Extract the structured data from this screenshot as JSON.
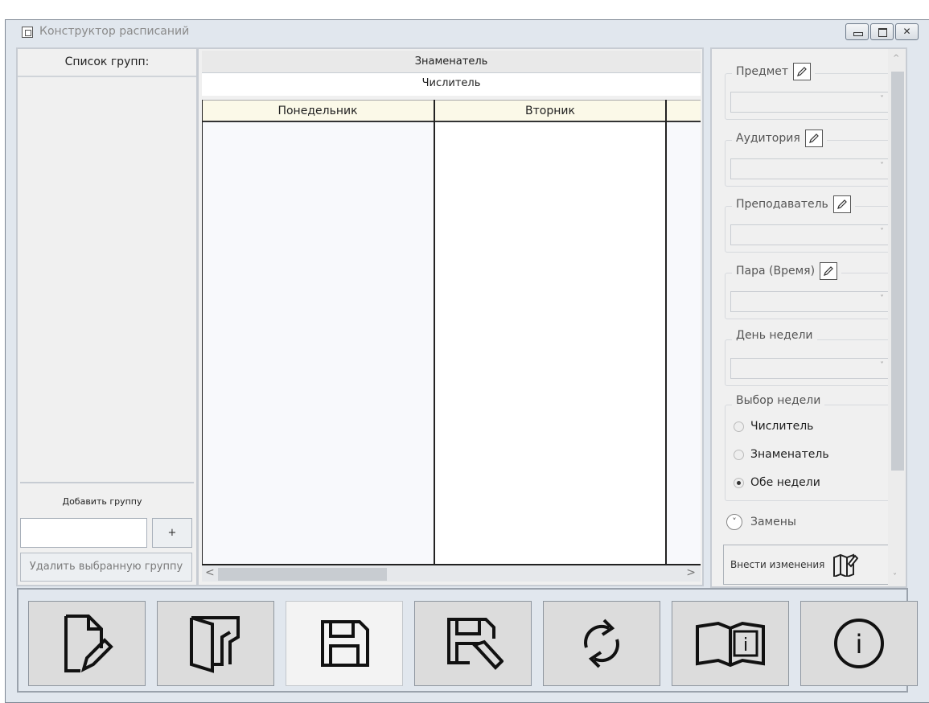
{
  "window": {
    "title": "Конструктор расписаний",
    "close_glyph": "✕"
  },
  "left_panel": {
    "header": "Список групп:",
    "add_label": "Добавить группу",
    "add_input_value": "",
    "add_button": "+",
    "delete_button": "Удалить выбранную группу"
  },
  "grid": {
    "denominator_header": "Знаменатель",
    "numerator_header": "Числитель",
    "days": [
      "Понедельник",
      "Вторник"
    ],
    "scroll_left": "<",
    "scroll_right": ">"
  },
  "right_panel": {
    "fields": [
      {
        "label": "Предмет",
        "icon": "pencil-icon",
        "value": ""
      },
      {
        "label": "Аудитория",
        "icon": "pencil-icon",
        "value": ""
      },
      {
        "label": "Преподаватель",
        "icon": "pencil-icon",
        "value": ""
      },
      {
        "label": "Пара (Время)",
        "icon": "pencil-icon",
        "value": ""
      },
      {
        "label": "День недели",
        "value": ""
      }
    ],
    "week_choice": {
      "label": "Выбор недели",
      "options": [
        "Числитель",
        "Знаменатель",
        "Обе недели"
      ],
      "selected": "Обе недели"
    },
    "replacements_label": "Замены",
    "apply_button": "Внести изменения"
  },
  "toolbar": {
    "buttons": [
      "new-document-icon",
      "open-folder-icon",
      "save-icon",
      "save-as-icon",
      "refresh-icon",
      "help-book-icon",
      "info-icon"
    ]
  },
  "colors": {
    "window_bg": "#e1e7ee",
    "day_header_bg": "#fbf9e8",
    "grid_col_bg": "#f8f9fc"
  }
}
